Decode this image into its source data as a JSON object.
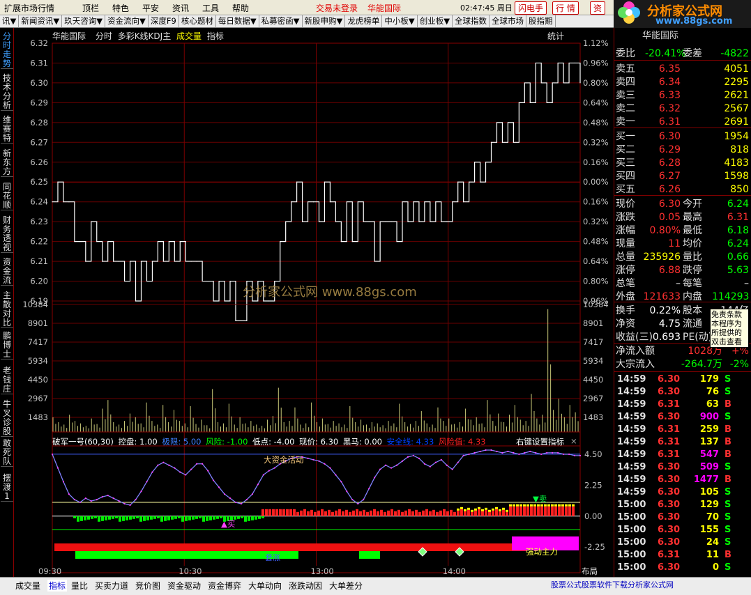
{
  "menu": {
    "items": [
      "扩展市场行情",
      "顶栏",
      "特色",
      "平安",
      "资讯",
      "工具",
      "帮助"
    ],
    "status": "交易未登录",
    "stock": "华能国际",
    "time": "02:47:45 周日",
    "buttons": [
      "闪电手",
      "行 情",
      "资"
    ]
  },
  "tabs": [
    "讯▼",
    "新闻资讯▼",
    "玖天咨询▼",
    "资金流向▼",
    "深度F9",
    "核心题材",
    "每日数据▼",
    "私募密函▼",
    "新股申购▼",
    "龙虎榜单",
    "中小板▼",
    "创业板▼",
    "全球指数",
    "全球市场",
    "股指期"
  ],
  "logo": {
    "title": "分析家公式网",
    "url": "www.88gs.com",
    "sub": "华能国际"
  },
  "chart_header": {
    "stock": "华能国际",
    "mode": "分时",
    "indicators": "多彩K线KDJ主",
    "vol": "成交量",
    "ind": "指标",
    "stat": "统计"
  },
  "left_nav": [
    "分时走势",
    "技术分析",
    "维赛特",
    "新东方",
    "同花顺",
    "财务透视",
    "资金流",
    "主散对比",
    "鹏博士",
    "老钱庄",
    "牛叉诊股",
    "敢死队",
    "摆渡1"
  ],
  "price_labels": [
    "6.32",
    "6.31",
    "6.30",
    "6.29",
    "6.28",
    "6.27",
    "6.26",
    "6.25",
    "6.24",
    "6.23",
    "6.22",
    "6.21",
    "6.20",
    "6.19"
  ],
  "pct_labels": [
    "1.12%",
    "0.96%",
    "0.80%",
    "0.64%",
    "0.48%",
    "0.32%",
    "0.16%",
    "0.00%",
    "0.16%",
    "0.32%",
    "0.48%",
    "0.64%",
    "0.80%",
    "0.96%"
  ],
  "vol_labels": [
    "10384",
    "8901",
    "7417",
    "5934",
    "4450",
    "2967",
    "1483"
  ],
  "watermark": "分析家公式网 www.88gs.com",
  "indicator": {
    "title": "破军一号(60,30)",
    "params": [
      {
        "k": "控盘:",
        "v": "1.00",
        "color": "#ffffff"
      },
      {
        "k": "极限:",
        "v": "5.00",
        "color": "#4080ff"
      },
      {
        "k": "风险:",
        "v": "-1.00",
        "color": "#00ff00"
      },
      {
        "k": "低点:",
        "v": "-4.00",
        "color": "#ffffff"
      },
      {
        "k": "现价:",
        "v": "6.30",
        "color": "#ffffff"
      },
      {
        "k": "黑马:",
        "v": "0.00",
        "color": "#ffffff"
      },
      {
        "k": "安全线:",
        "v": "4.33",
        "color": "#0040ff"
      },
      {
        "k": "风险值:",
        "v": "4.33",
        "color": "#ff2020"
      }
    ],
    "setting": "右键设置指标",
    "labels": [
      "4.50",
      "2.25",
      "0.00",
      "-2.25"
    ],
    "annotations": {
      "big": "大资金活动",
      "buy": "买",
      "sell": "卖",
      "strong": "强动主力",
      "huan": "套涨"
    }
  },
  "time_axis": [
    "09:30",
    "10:30",
    "13:00",
    "14:00"
  ],
  "layout_btn": "布局",
  "orderbook": {
    "wb": {
      "label": "委比",
      "value": "-20.41%",
      "label2": "委差",
      "value2": "-4822"
    },
    "sells": [
      {
        "label": "卖五",
        "price": "6.35",
        "vol": "4051"
      },
      {
        "label": "卖四",
        "price": "6.34",
        "vol": "2295"
      },
      {
        "label": "卖三",
        "price": "6.33",
        "vol": "2621"
      },
      {
        "label": "卖二",
        "price": "6.32",
        "vol": "2567"
      },
      {
        "label": "卖一",
        "price": "6.31",
        "vol": "2691"
      }
    ],
    "buys": [
      {
        "label": "买一",
        "price": "6.30",
        "vol": "1954"
      },
      {
        "label": "买二",
        "price": "6.29",
        "vol": "818"
      },
      {
        "label": "买三",
        "price": "6.28",
        "vol": "4183"
      },
      {
        "label": "买四",
        "price": "6.27",
        "vol": "1598"
      },
      {
        "label": "买五",
        "price": "6.26",
        "vol": "850"
      }
    ]
  },
  "quote": [
    {
      "l1": "现价",
      "v1": "6.30",
      "c1": "#ff3030",
      "l2": "今开",
      "v2": "6.24",
      "c2": "#00ff00"
    },
    {
      "l1": "涨跌",
      "v1": "0.05",
      "c1": "#ff3030",
      "l2": "最高",
      "v2": "6.31",
      "c2": "#ff3030"
    },
    {
      "l1": "涨幅",
      "v1": "0.80%",
      "c1": "#ff3030",
      "l2": "最低",
      "v2": "6.18",
      "c2": "#00ff00"
    },
    {
      "l1": "现量",
      "v1": "11",
      "c1": "#ff3030",
      "l2": "均价",
      "v2": "6.24",
      "c2": "#00ff00"
    },
    {
      "l1": "总量",
      "v1": "235926",
      "c1": "#ffff00",
      "l2": "量比",
      "v2": "0.66",
      "c2": "#00ff00"
    },
    {
      "l1": "涨停",
      "v1": "6.88",
      "c1": "#ff3030",
      "l2": "跌停",
      "v2": "5.63",
      "c2": "#00ff00"
    },
    {
      "l1": "总笔",
      "v1": "–",
      "c1": "#ffffff",
      "l2": "每笔",
      "v2": "–",
      "c2": "#ffffff"
    },
    {
      "l1": "外盘",
      "v1": "121633",
      "c1": "#ff3030",
      "l2": "内盘",
      "v2": "114293",
      "c2": "#00ff00"
    }
  ],
  "extra": [
    {
      "l1": "换手",
      "v1": "0.22%",
      "c1": "#ffffff",
      "l2": "股本",
      "v2": "144亿",
      "c2": "#ffffff"
    },
    {
      "l1": "净资",
      "v1": "4.75",
      "c1": "#ffffff",
      "l2": "流通",
      "v2": "",
      "c2": "#ffffff"
    },
    {
      "l1": "收益(三)",
      "v1": "0.693",
      "c1": "#ffffff",
      "l2": "PE(动)",
      "v2": "",
      "c2": "#ffffff"
    }
  ],
  "flow": [
    {
      "label": "净流入额",
      "value": "1028万",
      "pct": "+%",
      "color": "#ff3030"
    },
    {
      "label": "大宗流入",
      "value": "-264.7万",
      "pct": "-2%",
      "color": "#00ff00"
    }
  ],
  "tooltip": [
    "免责条款",
    "本程序为",
    "所提供的",
    "双击查看"
  ],
  "trades": [
    {
      "t": "14:59",
      "p": "6.30",
      "v": "179",
      "s": "S",
      "vc": "#ffff00"
    },
    {
      "t": "14:59",
      "p": "6.30",
      "v": "76",
      "s": "S",
      "vc": "#ffff00"
    },
    {
      "t": "14:59",
      "p": "6.31",
      "v": "63",
      "s": "B",
      "vc": "#ffff00"
    },
    {
      "t": "14:59",
      "p": "6.30",
      "v": "900",
      "s": "S",
      "vc": "#ff00ff"
    },
    {
      "t": "14:59",
      "p": "6.31",
      "v": "259",
      "s": "B",
      "vc": "#ffff00"
    },
    {
      "t": "14:59",
      "p": "6.31",
      "v": "137",
      "s": "B",
      "vc": "#ffff00"
    },
    {
      "t": "14:59",
      "p": "6.31",
      "v": "547",
      "s": "B",
      "vc": "#ff00ff"
    },
    {
      "t": "14:59",
      "p": "6.30",
      "v": "509",
      "s": "S",
      "vc": "#ff00ff"
    },
    {
      "t": "14:59",
      "p": "6.30",
      "v": "1477",
      "s": "B",
      "vc": "#ff00ff"
    },
    {
      "t": "14:59",
      "p": "6.30",
      "v": "105",
      "s": "S",
      "vc": "#ffff00"
    },
    {
      "t": "15:00",
      "p": "6.30",
      "v": "129",
      "s": "S",
      "vc": "#ffff00"
    },
    {
      "t": "15:00",
      "p": "6.30",
      "v": "70",
      "s": "S",
      "vc": "#ffff00"
    },
    {
      "t": "15:00",
      "p": "6.30",
      "v": "155",
      "s": "S",
      "vc": "#ffff00"
    },
    {
      "t": "15:00",
      "p": "6.30",
      "v": "24",
      "s": "S",
      "vc": "#ffff00"
    },
    {
      "t": "15:00",
      "p": "6.31",
      "v": "11",
      "s": "B",
      "vc": "#ffff00"
    },
    {
      "t": "15:00",
      "p": "6.30",
      "v": "0",
      "s": "S",
      "vc": "#ffff00"
    }
  ],
  "bottom_tabs": [
    "成交量",
    "指标",
    "量比",
    "买卖力道",
    "竞价图",
    "资金驱动",
    "资金博弈",
    "大单动向",
    "涨跌动因",
    "大单差分"
  ],
  "bottom_right": "股票公式股票软件下载分析家公式网",
  "chart_data": {
    "type": "line",
    "title": "",
    "ylim": [
      6.18,
      6.32
    ],
    "prices": [
      6.24,
      6.25,
      6.24,
      6.24,
      6.22,
      6.22,
      6.21,
      6.23,
      6.22,
      6.21,
      6.22,
      6.21,
      6.21,
      6.2,
      6.21,
      6.19,
      6.21,
      6.2,
      6.21,
      6.22,
      6.21,
      6.22,
      6.21,
      6.22,
      6.21,
      6.21,
      6.21,
      6.2,
      6.2,
      6.19,
      6.2,
      6.19,
      6.2,
      6.18,
      6.18,
      6.2,
      6.19,
      6.2,
      6.19,
      6.19,
      6.2,
      6.22,
      6.23,
      6.24,
      6.25,
      6.23,
      6.24,
      6.24,
      6.23,
      6.25,
      6.24,
      6.23,
      6.22,
      6.24,
      6.22,
      6.24,
      6.23,
      6.23,
      6.21,
      6.23,
      6.23,
      6.23,
      6.22,
      6.24,
      6.23,
      6.24,
      6.23,
      6.24,
      6.23,
      6.24,
      6.23,
      6.23,
      6.24,
      6.25,
      6.24,
      6.25,
      6.26,
      6.25,
      6.26,
      6.27,
      6.28,
      6.27,
      6.28,
      6.27,
      6.29,
      6.3,
      6.29,
      6.31,
      6.3,
      6.29,
      6.3,
      6.31,
      6.3,
      6.31,
      6.31,
      6.3
    ],
    "volumes": [
      1200,
      800,
      600,
      1400,
      900,
      700,
      500,
      1100,
      650,
      1900,
      2600,
      800,
      600,
      900,
      1500,
      1200,
      700,
      2400,
      900,
      600,
      2200,
      800,
      1800,
      900,
      700,
      2100,
      650,
      1000,
      550,
      3500,
      800,
      700,
      2300,
      600,
      1200,
      700,
      900,
      600,
      500,
      1000,
      1300,
      3600,
      800,
      900,
      2000,
      600,
      700,
      2400,
      800,
      1100,
      650,
      900,
      700,
      600,
      2100,
      800,
      1000,
      600,
      800,
      700,
      550,
      900,
      700,
      2300,
      800,
      650,
      900,
      1700,
      700,
      600,
      2000,
      900,
      1100,
      650,
      800,
      1900,
      1000,
      1200,
      700,
      2600,
      900,
      1500,
      800,
      1400,
      2200,
      1000,
      900,
      3100,
      1100,
      1400,
      10000,
      1800,
      2700,
      1200,
      2200,
      1600
    ],
    "vol_max": 10384,
    "indicator": [
      4.5,
      3.5,
      2.5,
      1.6,
      1.2,
      1.0,
      1.3,
      1.1,
      1.2,
      1.4,
      1.5,
      1.3,
      1.1,
      0.9,
      0.8,
      1.2,
      1.8,
      2.5,
      3.2,
      3.7,
      3.9,
      3.7,
      3.5,
      3.2,
      3.0,
      3.4,
      3.8,
      3.8,
      3.3,
      2.6,
      2.1,
      1.6,
      1.3,
      1.0,
      0.9,
      1.2,
      1.6,
      2.3,
      3.0,
      3.3,
      3.5,
      3.8,
      4.0,
      4.2,
      4.3,
      4.3,
      4.2,
      4.1,
      4.0,
      3.8,
      3.5,
      3.0,
      2.5,
      1.8,
      1.2,
      0.9,
      1.2,
      2.0,
      2.8,
      3.4,
      3.7,
      3.5,
      3.7,
      4.0,
      4.3,
      4.4,
      4.2,
      3.8,
      3.6,
      3.9,
      4.1,
      3.7,
      3.4,
      3.9,
      4.4,
      4.5,
      4.6,
      4.7,
      4.8,
      4.8,
      4.7,
      4.6,
      4.7,
      4.6,
      4.5,
      4.6,
      4.7,
      4.6,
      4.5,
      4.6,
      4.6,
      4.6,
      4.5,
      4.5,
      4.4,
      4.4
    ]
  }
}
